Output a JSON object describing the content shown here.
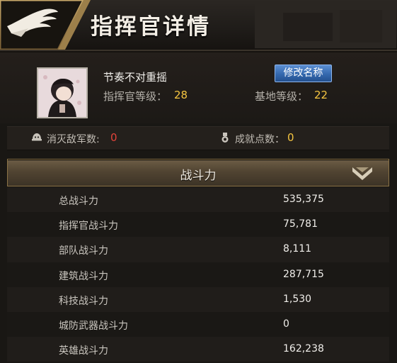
{
  "header": {
    "title": "指挥官详情"
  },
  "profile": {
    "name": "节奏不对重摇",
    "rename_button": "修改名称",
    "commander_level_label": "指挥官等级：",
    "commander_level": "28",
    "base_level_label": "基地等级：",
    "base_level": "22"
  },
  "stats": {
    "kills_label": "消灭敌军数:",
    "kills": "0",
    "achievement_label": "成就点数：",
    "achievement": "0"
  },
  "section": {
    "title": "战斗力"
  },
  "power_rows": [
    {
      "label": "总战斗力",
      "value": "535,375"
    },
    {
      "label": "指挥官战斗力",
      "value": "75,781"
    },
    {
      "label": "部队战斗力",
      "value": "8,111"
    },
    {
      "label": "建筑战斗力",
      "value": "287,715"
    },
    {
      "label": "科技战斗力",
      "value": "1,530"
    },
    {
      "label": "城防武器战斗力",
      "value": "0"
    },
    {
      "label": "英雄战斗力",
      "value": "162,238"
    }
  ],
  "colors": {
    "accent_gold": "#f5c540",
    "kill_red": "#e2433a",
    "button_blue": "#3468ae"
  },
  "icons": {
    "logo": "eagle-emblem-icon",
    "kills": "helmet-icon",
    "achievement": "medal-icon",
    "collapse": "chevron-down-icon"
  }
}
